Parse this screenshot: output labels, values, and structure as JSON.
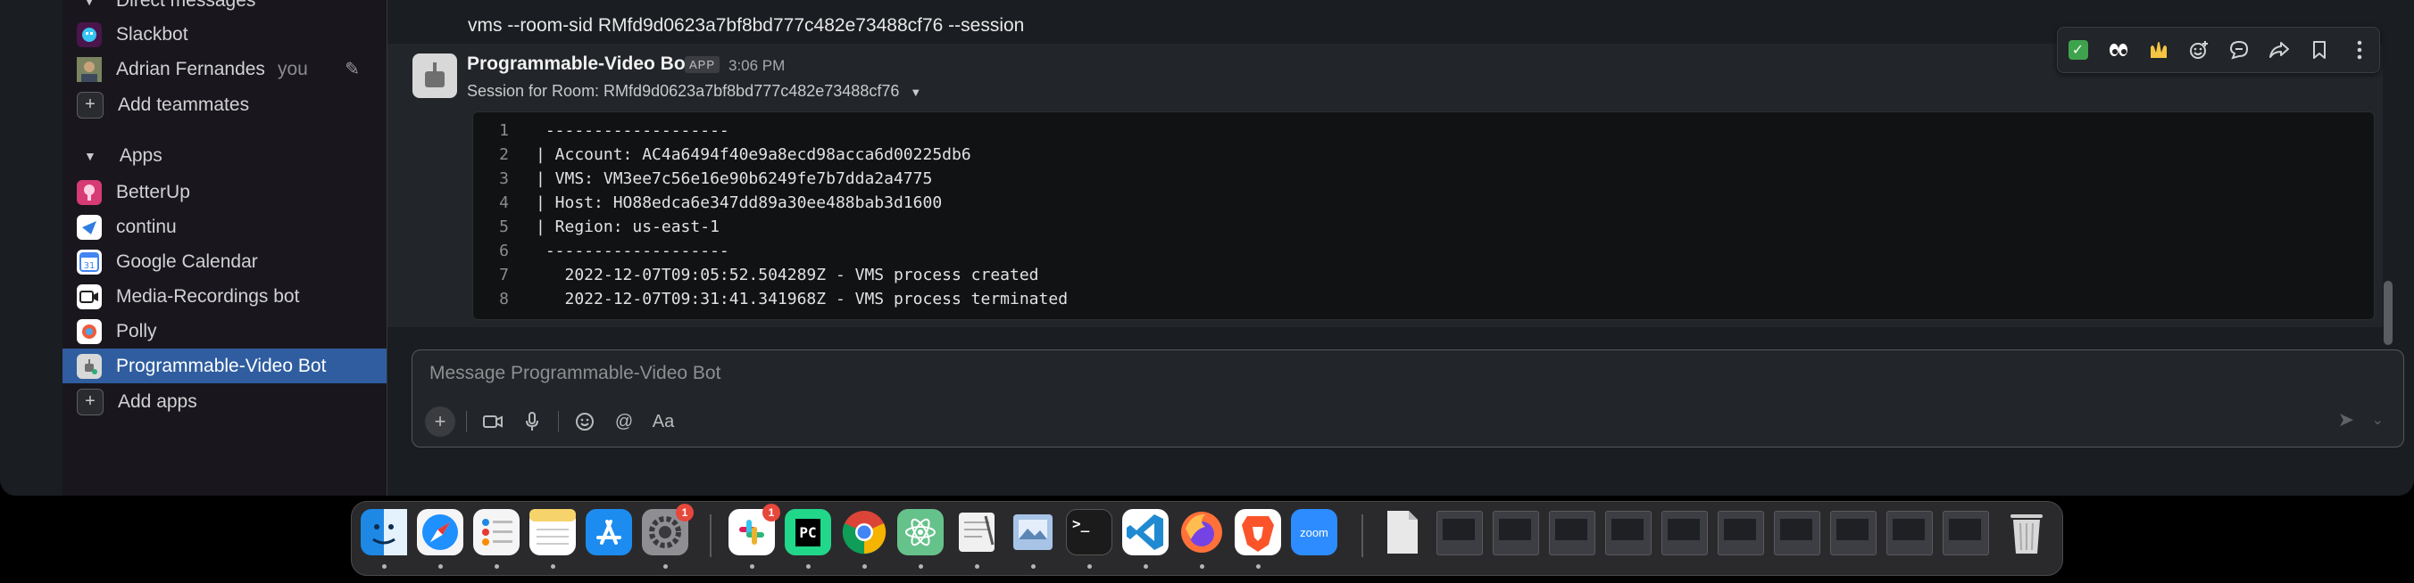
{
  "sidebar": {
    "direct_messages_header": "Direct messages",
    "dms": [
      {
        "label": "Slackbot",
        "icon": "slackbot-icon"
      },
      {
        "label": "Adrian Fernandes",
        "suffix": "you",
        "icon": "avatar"
      }
    ],
    "add_teammates": "Add teammates",
    "apps_header": "Apps",
    "apps": [
      {
        "label": "BetterUp",
        "icon": "betterup-icon",
        "color": "#d63b73"
      },
      {
        "label": "continu",
        "icon": "continu-icon",
        "color": "#2f7de1"
      },
      {
        "label": "Google Calendar",
        "icon": "calendar-icon",
        "color": "#4285f4"
      },
      {
        "label": "Media-Recordings bot",
        "icon": "video-icon",
        "color": "#ffffff"
      },
      {
        "label": "Polly",
        "icon": "polly-icon",
        "color": "#f15a3a"
      },
      {
        "label": "Programmable-Video Bot",
        "icon": "robot-icon",
        "color": "#d8d8d8"
      }
    ],
    "add_apps": "Add apps"
  },
  "main": {
    "prev_message_text": "vms --room-sid RMfd9d0623a7bf8bd777c482e73488cf76 --session",
    "message": {
      "sender": "Programmable-Video Bot",
      "badge": "APP",
      "time": "3:06 PM",
      "session_line": "Session for Room: RMfd9d0623a7bf8bd777c482e73488cf76",
      "code_lines": [
        {
          "n": "1",
          "text": " -------------------"
        },
        {
          "n": "2",
          "text": "| Account: AC4a6494f40e9a8ecd98acca6d00225db6"
        },
        {
          "n": "3",
          "text": "| VMS: VM3ee7c56e16e90b6249fe7b7dda2a4775"
        },
        {
          "n": "4",
          "text": "| Host: HO88edca6e347dd89a30ee488bab3d1600"
        },
        {
          "n": "5",
          "text": "| Region: us-east-1"
        },
        {
          "n": "6",
          "text": " -------------------"
        },
        {
          "n": "7",
          "text": "   2022-12-07T09:05:52.504289Z - VMS process created"
        },
        {
          "n": "8",
          "text": "   2022-12-07T09:31:41.341968Z - VMS process terminated"
        }
      ]
    },
    "action_bar": [
      "check-emoji",
      "eyes-emoji",
      "raised-hands-emoji",
      "add-reaction-icon",
      "reply-thread-icon",
      "share-icon",
      "bookmark-icon",
      "more-icon"
    ],
    "composer": {
      "placeholder": "Message Programmable-Video Bot",
      "format_label": "Aa"
    }
  },
  "dock": {
    "apps": [
      {
        "name": "finder",
        "color": "#1e88e5",
        "running": true
      },
      {
        "name": "safari",
        "color": "#1e90ff",
        "running": true
      },
      {
        "name": "reminders",
        "color": "#f5f5f5",
        "running": true
      },
      {
        "name": "notes",
        "color": "#f6d46b",
        "running": true
      },
      {
        "name": "app-store",
        "color": "#1d8cf0",
        "running": true
      },
      {
        "name": "system-settings",
        "color": "#8e8e93",
        "running": true,
        "badge": "1"
      },
      {
        "name": "slack",
        "color": "#ffffff",
        "running": true,
        "badge": "1"
      },
      {
        "name": "pycharm",
        "color": "#21d789",
        "running": true,
        "label": "PC"
      },
      {
        "name": "chrome",
        "color": "#ffffff",
        "running": true
      },
      {
        "name": "atom",
        "color": "#66c28b",
        "running": true
      },
      {
        "name": "textedit",
        "color": "#f0f0f0",
        "running": true
      },
      {
        "name": "preview",
        "color": "#a7c4e6",
        "running": true
      },
      {
        "name": "terminal",
        "color": "#1b1b1b",
        "running": true,
        "label": ">_"
      },
      {
        "name": "vscode",
        "color": "#1f8ad2",
        "running": true
      },
      {
        "name": "firefox",
        "color": "#ff7139",
        "running": true
      },
      {
        "name": "brave",
        "color": "#fb542b",
        "running": true
      },
      {
        "name": "zoom",
        "color": "#2d8cff",
        "running": false,
        "label": "zoom"
      }
    ]
  }
}
